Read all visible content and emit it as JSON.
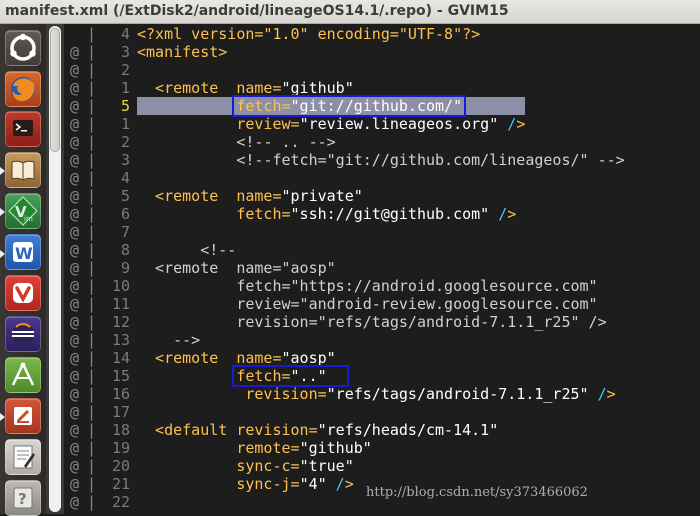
{
  "window": {
    "title": "manifest.xml (/ExtDisk2/android/lineageOS14.1/.repo) - GVIM15"
  },
  "launcher": {
    "items": [
      "ubuntu-dash-icon",
      "firefox-icon",
      "terminal-icon",
      "book-reader-icon",
      "vim-icon",
      "wps-writer-icon",
      "vivaldi-icon",
      "eclipse-icon",
      "android-studio-icon",
      "presentation-icon",
      "text-editor-icon",
      "unknown-app-icon"
    ]
  },
  "colors": {
    "tag": "#ffc14d",
    "string": "#ffffff",
    "slash": "#4fc8ff",
    "comment": "#d0d0d0",
    "selection": "#8d8fa6",
    "annotation_box": "#1a1ad6",
    "current_line_number": "#e6d93c"
  },
  "editor": {
    "current_line": 5,
    "lines": [
      {
        "sign": "",
        "bar": "|",
        "num": "4",
        "parts": [
          {
            "t": "<?xml version=\"1.0\" encoding=\"UTF-8\"?>",
            "c": "t"
          }
        ]
      },
      {
        "sign": "@",
        "bar": "|",
        "num": "3",
        "parts": [
          {
            "t": "<manifest>",
            "c": "t"
          }
        ]
      },
      {
        "sign": "@",
        "bar": "|",
        "num": "2",
        "parts": []
      },
      {
        "sign": "@",
        "bar": "|",
        "num": "1",
        "parts": [
          {
            "t": "  <remote  ",
            "c": "t"
          },
          {
            "t": "name=",
            "c": "a"
          },
          {
            "t": "\"github\"",
            "c": "s"
          }
        ]
      },
      {
        "sign": "@",
        "bar": "|",
        "num": "5",
        "current": true,
        "parts": [
          {
            "t": "           fetch=",
            "c": "a"
          },
          {
            "t": "\"git://github.com/\"",
            "c": "s"
          }
        ]
      },
      {
        "sign": "@",
        "bar": "|",
        "num": "1",
        "parts": [
          {
            "t": "           review=",
            "c": "a"
          },
          {
            "t": "\"review.lineageos.org\"",
            "c": "s"
          },
          {
            "t": " /",
            "c": "b"
          },
          {
            "t": ">",
            "c": "t"
          }
        ]
      },
      {
        "sign": "@",
        "bar": "|",
        "num": "2",
        "parts": [
          {
            "t": "           <!-- .. -->",
            "c": "c"
          }
        ]
      },
      {
        "sign": "@",
        "bar": "|",
        "num": "3",
        "parts": [
          {
            "t": "           <!--fetch=\"git://github.com/lineageos/\" -->",
            "c": "c"
          }
        ]
      },
      {
        "sign": "@",
        "bar": "|",
        "num": "4",
        "parts": []
      },
      {
        "sign": "@",
        "bar": "|",
        "num": "5",
        "parts": [
          {
            "t": "  <remote  ",
            "c": "t"
          },
          {
            "t": "name=",
            "c": "a"
          },
          {
            "t": "\"private\"",
            "c": "s"
          }
        ]
      },
      {
        "sign": "@",
        "bar": "|",
        "num": "6",
        "parts": [
          {
            "t": "           fetch=",
            "c": "a"
          },
          {
            "t": "\"ssh://git@github.com\"",
            "c": "s"
          },
          {
            "t": " /",
            "c": "b"
          },
          {
            "t": ">",
            "c": "t"
          }
        ]
      },
      {
        "sign": "@",
        "bar": "|",
        "num": "7",
        "parts": []
      },
      {
        "sign": "@",
        "bar": "|",
        "num": "8",
        "parts": [
          {
            "t": "       <!--",
            "c": "c"
          }
        ]
      },
      {
        "sign": "@",
        "bar": "|",
        "num": "9",
        "parts": [
          {
            "t": "  <remote  name=\"aosp\"",
            "c": "c"
          }
        ]
      },
      {
        "sign": "@",
        "bar": "|",
        "num": "10",
        "parts": [
          {
            "t": "           fetch=\"https://android.googlesource.com\"",
            "c": "c"
          }
        ]
      },
      {
        "sign": "@",
        "bar": "|",
        "num": "11",
        "parts": [
          {
            "t": "           review=\"android-review.googlesource.com\"",
            "c": "c"
          }
        ]
      },
      {
        "sign": "@",
        "bar": "|",
        "num": "12",
        "parts": [
          {
            "t": "           revision=\"refs/tags/android-7.1.1_r25\" />",
            "c": "c"
          }
        ]
      },
      {
        "sign": "@",
        "bar": "|",
        "num": "13",
        "parts": [
          {
            "t": "    -->",
            "c": "c"
          }
        ]
      },
      {
        "sign": "@",
        "bar": "|",
        "num": "14",
        "parts": [
          {
            "t": "  <remote  ",
            "c": "t"
          },
          {
            "t": "name=",
            "c": "a"
          },
          {
            "t": "\"aosp\"",
            "c": "s"
          }
        ]
      },
      {
        "sign": "@",
        "bar": "|",
        "num": "15",
        "parts": [
          {
            "t": "           fetch=",
            "c": "a"
          },
          {
            "t": "\"..\"",
            "c": "s"
          }
        ]
      },
      {
        "sign": "@",
        "bar": "|",
        "num": "16",
        "parts": [
          {
            "t": "            revision=",
            "c": "a"
          },
          {
            "t": "\"refs/tags/android-7.1.1_r25\"",
            "c": "s"
          },
          {
            "t": " /",
            "c": "b"
          },
          {
            "t": ">",
            "c": "t"
          }
        ]
      },
      {
        "sign": "@",
        "bar": "|",
        "num": "17",
        "parts": []
      },
      {
        "sign": "@",
        "bar": "|",
        "num": "18",
        "parts": [
          {
            "t": "  <default ",
            "c": "t"
          },
          {
            "t": "revision=",
            "c": "a"
          },
          {
            "t": "\"refs/heads/cm-14.1\"",
            "c": "s"
          }
        ]
      },
      {
        "sign": "@",
        "bar": "|",
        "num": "19",
        "parts": [
          {
            "t": "           remote=",
            "c": "a"
          },
          {
            "t": "\"github\"",
            "c": "s"
          }
        ]
      },
      {
        "sign": "@",
        "bar": "|",
        "num": "20",
        "parts": [
          {
            "t": "           sync-c=",
            "c": "a"
          },
          {
            "t": "\"true\"",
            "c": "s"
          }
        ]
      },
      {
        "sign": "@",
        "bar": "|",
        "num": "21",
        "parts": [
          {
            "t": "           sync-j=",
            "c": "a"
          },
          {
            "t": "\"4\"",
            "c": "s"
          },
          {
            "t": " /",
            "c": "b"
          },
          {
            "t": ">",
            "c": "t"
          }
        ]
      },
      {
        "sign": "@",
        "bar": "|",
        "num": "22",
        "parts": []
      }
    ]
  },
  "watermark": {
    "text": "http://blog.csdn.net/sy373466062"
  }
}
